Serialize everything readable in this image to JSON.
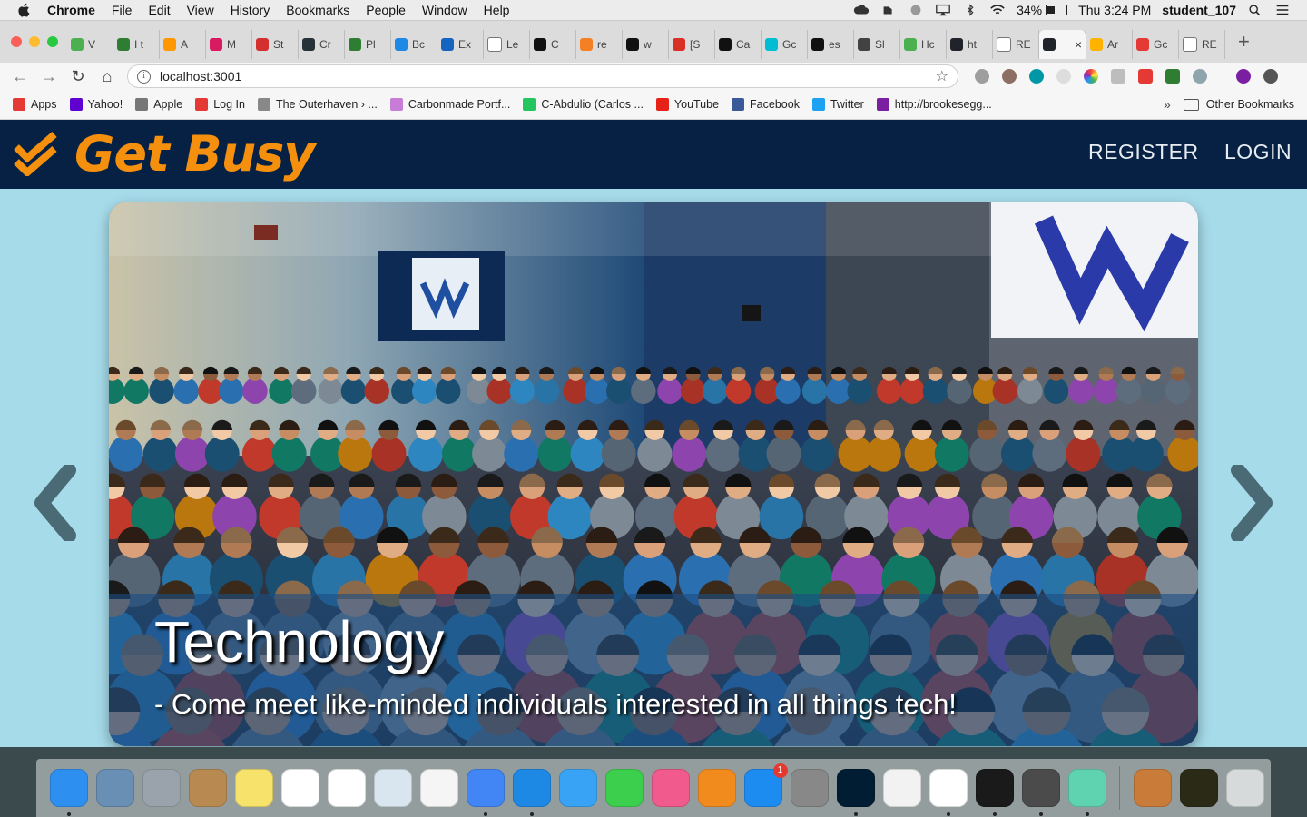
{
  "menubar": {
    "app_name": "Chrome",
    "items": [
      "File",
      "Edit",
      "View",
      "History",
      "Bookmarks",
      "People",
      "Window",
      "Help"
    ],
    "battery": "34%",
    "battery_level": 0.34,
    "clock": "Thu 3:24 PM",
    "user": "student_107"
  },
  "tabs": [
    {
      "label": "V",
      "icon": "leaf-icon",
      "color": "#4caf50"
    },
    {
      "label": "I t",
      "icon": "terminal-icon",
      "color": "#2e7d32"
    },
    {
      "label": "A",
      "icon": "asterisk-icon",
      "color": "#ff9800"
    },
    {
      "label": "M",
      "icon": "meetup-icon",
      "color": "#d81b60"
    },
    {
      "label": "St",
      "icon": "arrow-icon",
      "color": "#d32f2f"
    },
    {
      "label": "Cr",
      "icon": "cap-icon",
      "color": "#263238"
    },
    {
      "label": "Pl",
      "icon": "terminal-icon",
      "color": "#2e7d32"
    },
    {
      "label": "Bc",
      "icon": "b-icon",
      "color": "#1e88e5"
    },
    {
      "label": "Ex",
      "icon": "dropbox-icon",
      "color": "#1565c0"
    },
    {
      "label": "Le",
      "icon": "page-icon",
      "color": "#ffffff"
    },
    {
      "label": "C",
      "icon": "github-icon",
      "color": "#111111"
    },
    {
      "label": "re",
      "icon": "stack-icon",
      "color": "#f48024"
    },
    {
      "label": "w",
      "icon": "github-icon",
      "color": "#111111"
    },
    {
      "label": "[S",
      "icon": "gmail-icon",
      "color": "#d93025"
    },
    {
      "label": "Ca",
      "icon": "github-icon",
      "color": "#111111"
    },
    {
      "label": "Gc",
      "icon": "circle-icon",
      "color": "#00bcd4"
    },
    {
      "label": "es",
      "icon": "github-icon",
      "color": "#111111"
    },
    {
      "label": "Sl",
      "icon": "grid-icon",
      "color": "#424242"
    },
    {
      "label": "Hc",
      "icon": "w3-icon",
      "color": "#4caf50"
    },
    {
      "label": "ht",
      "icon": "react-icon",
      "color": "#20232a"
    },
    {
      "label": "RE",
      "icon": "page-icon",
      "color": "#ffffff"
    },
    {
      "label": "",
      "icon": "react-icon",
      "color": "#20232a",
      "active": true
    },
    {
      "label": "Ar",
      "icon": "ball-icon",
      "color": "#ffb300"
    },
    {
      "label": "Gc",
      "icon": "f-icon",
      "color": "#e53935"
    },
    {
      "label": "RE",
      "icon": "page-icon",
      "color": "#ffffff"
    }
  ],
  "toolbar": {
    "url": "localhost:3001"
  },
  "bookmarks": [
    {
      "label": "Apps",
      "icon": "apps-icon",
      "color": "#e53935"
    },
    {
      "label": "Yahoo!",
      "icon": "yahoo-icon",
      "color": "#5f01d1"
    },
    {
      "label": "Apple",
      "icon": "apple-icon",
      "color": "#777777"
    },
    {
      "label": "Log In",
      "icon": "warning-icon",
      "color": "#e53935"
    },
    {
      "label": "The Outerhaven › ...",
      "icon": "outerhaven-icon",
      "color": "#888888"
    },
    {
      "label": "Carbonmade Portf...",
      "icon": "carbonmade-icon",
      "color": "#c77dd6"
    },
    {
      "label": "C-Abdulio (Carlos ...",
      "icon": "lightning-icon",
      "color": "#22c55e"
    },
    {
      "label": "YouTube",
      "icon": "youtube-icon",
      "color": "#e62117"
    },
    {
      "label": "Facebook",
      "icon": "facebook-icon",
      "color": "#3b5998"
    },
    {
      "label": "Twitter",
      "icon": "twitter-icon",
      "color": "#1da1f2"
    },
    {
      "label": "http://brookesegg...",
      "icon": "star-icon",
      "color": "#7b1fa2"
    }
  ],
  "bookmarks_more": "»",
  "bookmarks_other": "Other Bookmarks",
  "site": {
    "brand": "Get Busy",
    "nav": {
      "register": "REGISTER",
      "login": "LOGIN"
    },
    "slide": {
      "title": "Technology",
      "text": "- Come meet like-minded individuals interested in all things tech!"
    }
  },
  "colors": {
    "header_bg": "#062143",
    "brand_orange": "#f5900f",
    "page_bg": "#a6dbea",
    "arrow": "#4a6b76"
  },
  "dock": [
    {
      "name": "finder-icon",
      "color": "#2d8ff0",
      "running": true
    },
    {
      "name": "mail-eagle-icon",
      "color": "#6a8fb5",
      "running": false
    },
    {
      "name": "launchpad-icon",
      "color": "#9aa3ab",
      "running": false
    },
    {
      "name": "contacts-icon",
      "color": "#b88a52",
      "running": false
    },
    {
      "name": "notes-icon",
      "color": "#f7e26b",
      "running": false
    },
    {
      "name": "reminders-icon",
      "color": "#ffffff",
      "running": false
    },
    {
      "name": "calendar-icon",
      "color": "#ffffff",
      "running": false
    },
    {
      "name": "preview-icon",
      "color": "#d9e6ef",
      "running": false
    },
    {
      "name": "photos-icon",
      "color": "#f5f5f5",
      "running": false
    },
    {
      "name": "chrome-icon",
      "color": "#4285f4",
      "running": true
    },
    {
      "name": "safari-icon",
      "color": "#1e88e5",
      "running": true
    },
    {
      "name": "messages-icon",
      "color": "#38a3f5",
      "running": false
    },
    {
      "name": "facetime-icon",
      "color": "#3ccf4e",
      "running": false
    },
    {
      "name": "itunes-icon",
      "color": "#f05a8c",
      "running": false
    },
    {
      "name": "ibooks-icon",
      "color": "#f28b1e",
      "running": false
    },
    {
      "name": "appstore-icon",
      "color": "#1c8cf0",
      "running": false,
      "badge": "1"
    },
    {
      "name": "system-prefs-icon",
      "color": "#888888",
      "running": false
    },
    {
      "name": "photoshop-icon",
      "color": "#001d34",
      "running": true
    },
    {
      "name": "textedit-icon",
      "color": "#f2f2f2",
      "running": false
    },
    {
      "name": "slack-icon",
      "color": "#ffffff",
      "running": true
    },
    {
      "name": "terminal-icon",
      "color": "#1a1a1a",
      "running": true
    },
    {
      "name": "sublime-icon",
      "color": "#4b4b4b",
      "running": true
    },
    {
      "name": "atom-icon",
      "color": "#5fd3b0",
      "running": true
    },
    {
      "name": "pages-icon",
      "color": "#c97b3a",
      "running": false
    },
    {
      "name": "bridge-icon",
      "color": "#2b2a17",
      "running": false
    },
    {
      "name": "trash-icon",
      "color": "#d6dadb",
      "running": false
    }
  ]
}
